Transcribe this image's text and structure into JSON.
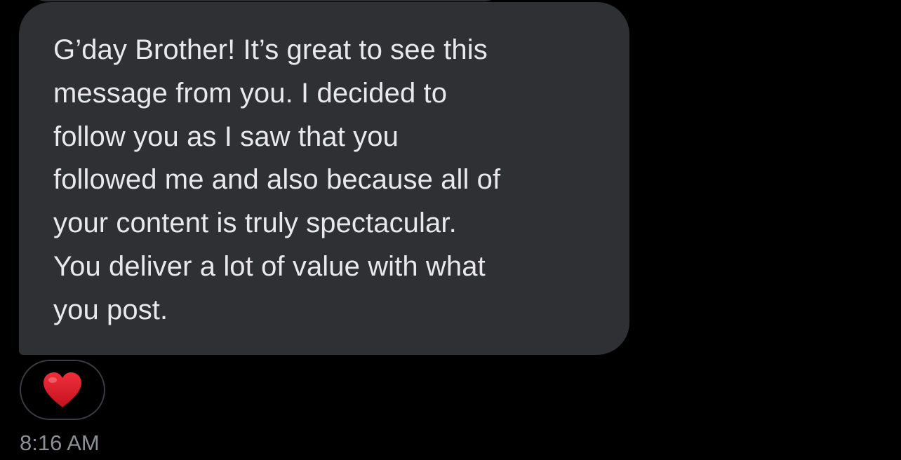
{
  "message": {
    "text": "G’day Brother! It’s great to see this\nmessage from you. I decided to\nfollow you as I saw that you\nfollowed me and also because all of\nyour content is truly spectacular.\nYou deliver a lot of value with what\nyou post."
  },
  "reaction": {
    "icon": "heart-icon",
    "color": "#dd1f2d"
  },
  "timestamp": "8:16 AM",
  "colors": {
    "background": "#000000",
    "bubble": "#2f3033",
    "message_text": "#e9e9eb",
    "timestamp": "#8b8e94"
  }
}
